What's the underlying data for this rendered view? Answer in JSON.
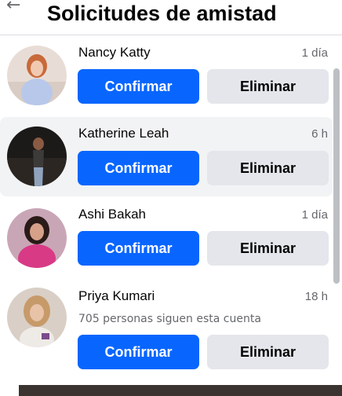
{
  "header": {
    "back_icon": "arrow-left-icon",
    "title": "Solicitudes de amistad"
  },
  "requests": [
    {
      "name": "Nancy Katty",
      "time": "1 día",
      "confirm_label": "Confirmar",
      "delete_label": "Eliminar"
    },
    {
      "name": "Katherine Leah",
      "time": "6 h",
      "confirm_label": "Confirmar",
      "delete_label": "Eliminar"
    },
    {
      "name": "Ashi Bakah",
      "time": "1 día",
      "confirm_label": "Confirmar",
      "delete_label": "Eliminar"
    },
    {
      "name": "Priya Kumari",
      "time": "18 h",
      "mutual": "705 personas siguen esta cuenta",
      "confirm_label": "Confirmar",
      "delete_label": "Eliminar"
    }
  ],
  "colors": {
    "confirm_bg": "#0866ff",
    "delete_bg": "#e4e6eb",
    "highlight_bg": "#f2f3f5"
  }
}
